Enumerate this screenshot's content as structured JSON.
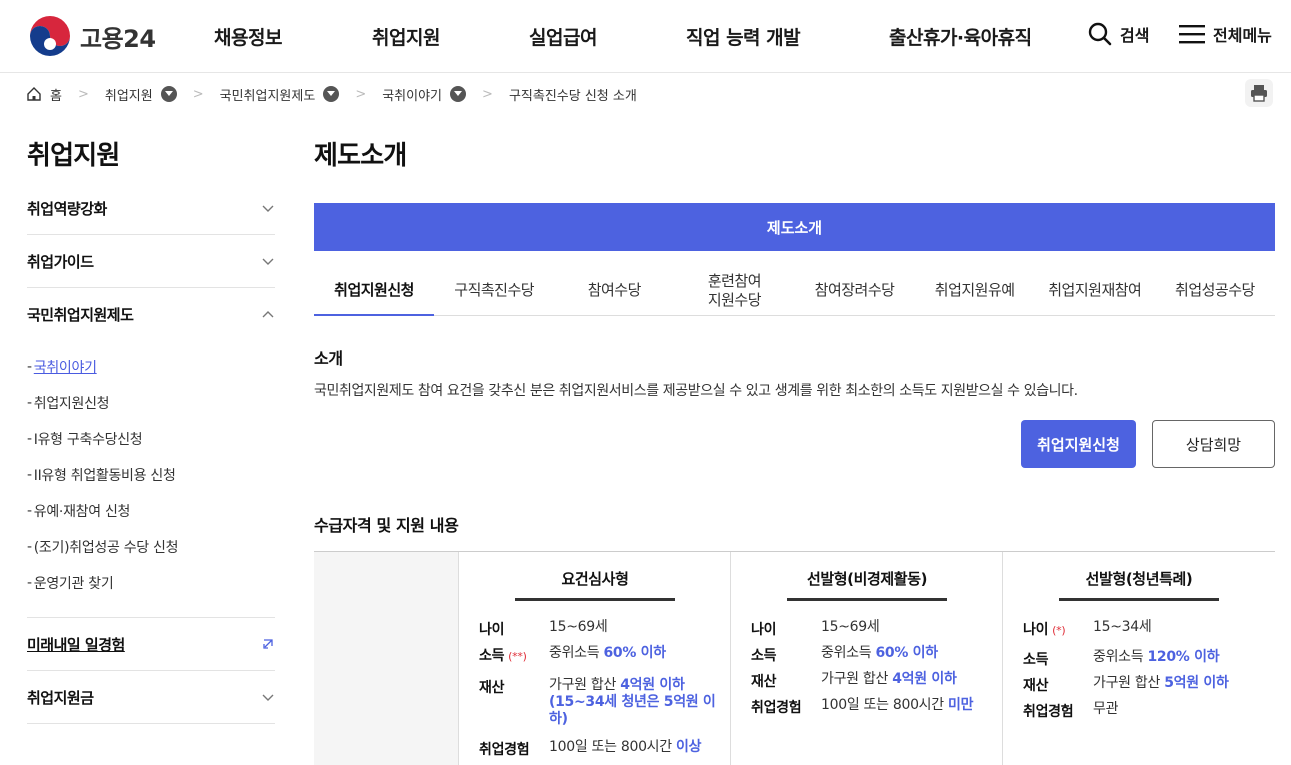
{
  "header": {
    "logo_text": "고용24",
    "nav": [
      "채용정보",
      "취업지원",
      "실업급여",
      "직업 능력 개발",
      "출산휴가·육아휴직"
    ],
    "search_label": "검색",
    "menu_label": "전체메뉴"
  },
  "breadcrumb": {
    "home": "홈",
    "items": [
      "취업지원",
      "국민취업지원제도",
      "국취이야기",
      "구직촉진수당 신청 소개"
    ]
  },
  "sidebar": {
    "title": "취업지원",
    "items": [
      "취업역량강화",
      "취업가이드",
      "국민취업지원제도"
    ],
    "sub_items": [
      "국취이야기",
      "취업지원신청",
      "I유형 구축수당신청",
      "II유형 취업활동비용 신청",
      "유예·재참여 신청",
      "(조기)취업성공 수당 신청",
      "운영기관 찾기"
    ],
    "dash": "-",
    "after_items": [
      "미래내일 일경험",
      "취업지원금"
    ]
  },
  "main": {
    "title": "제도소개",
    "banner": "제도소개",
    "tabs": [
      "취업지원신청",
      "구직촉진수당",
      "참여수당",
      "훈련참여\n지원수당",
      "참여장려수당",
      "취업지원유예",
      "취업지원재참여",
      "취업성공수당"
    ],
    "intro_heading": "소개",
    "intro_text": "국민취업지원제도 참여 요건을 갖추신 분은 취업지원서비스를 제공받으실 수 있고 생계를 위한 최소한의 소득도 지원받으실 수 있습니다.",
    "btn_apply": "취업지원신청",
    "btn_consult": "상담희망",
    "eligibility_heading": "수급자격 및 지원 내용"
  },
  "table": {
    "columns": [
      {
        "title": "요건심사형",
        "rows": [
          {
            "label": "나이",
            "mark": "",
            "value": "15~69세",
            "hl": ""
          },
          {
            "label": "소득",
            "mark": "(**)",
            "value": "중위소득 ",
            "hl": "60% 이하"
          },
          {
            "label": "재산",
            "mark": "",
            "value": "가구원 합산 ",
            "hl": "4억원 이하 (15~34세 청년은 5억원 이하)"
          },
          {
            "label": "취업경험",
            "mark": "",
            "value": "100일 또는 800시간 ",
            "hl": "이상"
          }
        ]
      },
      {
        "title": "선발형(비경제활동)",
        "rows": [
          {
            "label": "나이",
            "mark": "",
            "value": "15~69세",
            "hl": ""
          },
          {
            "label": "소득",
            "mark": "",
            "value": "중위소득 ",
            "hl": "60% 이하"
          },
          {
            "label": "재산",
            "mark": "",
            "value": "가구원 합산 ",
            "hl": "4억원 이하"
          },
          {
            "label": "취업경험",
            "mark": "",
            "value": "100일 또는 800시간 ",
            "hl": "미만"
          }
        ]
      },
      {
        "title": "선발형(청년특례)",
        "rows": [
          {
            "label": "나이",
            "mark": "(*)",
            "value": "15~34세",
            "hl": ""
          },
          {
            "label": "소득",
            "mark": "",
            "value": "중위소득 ",
            "hl": "120% 이하"
          },
          {
            "label": "재산",
            "mark": "",
            "value": "가구원 합산 ",
            "hl": "5억원 이하"
          },
          {
            "label": "취업경험",
            "mark": "",
            "value": "무관",
            "hl": ""
          }
        ]
      }
    ]
  },
  "colors": {
    "accent": "#4d62e0",
    "mark": "#e0303a"
  }
}
